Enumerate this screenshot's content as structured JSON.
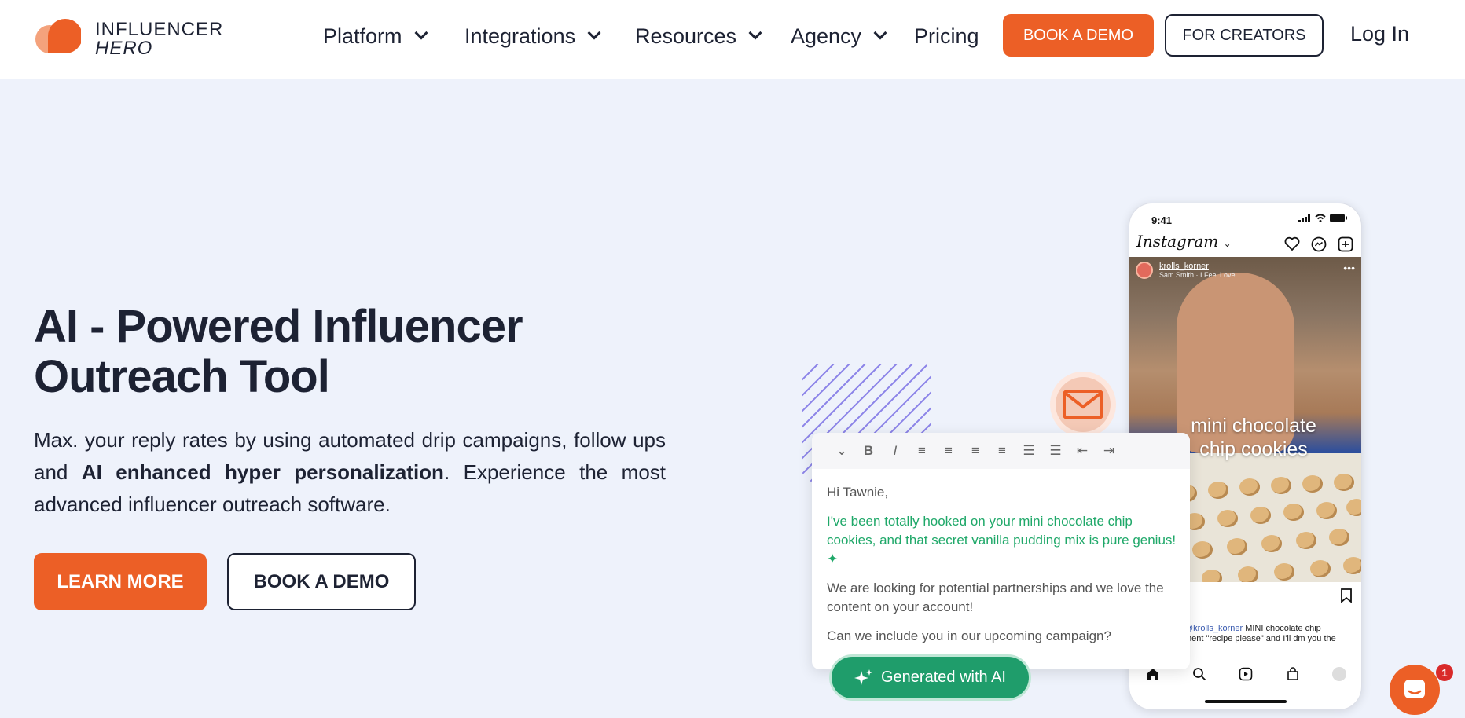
{
  "brand": {
    "line1": "INFLUENCER",
    "line2": "HERO",
    "accent": "#ec5f26",
    "ink": "#1d2233",
    "background": "#eef2fb"
  },
  "nav": {
    "items": [
      {
        "label": "Platform",
        "has_dropdown": true
      },
      {
        "label": "Integrations",
        "has_dropdown": true
      },
      {
        "label": "Resources",
        "has_dropdown": true
      },
      {
        "label": "Agency",
        "has_dropdown": true
      },
      {
        "label": "Pricing",
        "has_dropdown": false
      }
    ],
    "book_demo": "BOOK A DEMO",
    "for_creators": "FOR CREATORS",
    "login": "Log In"
  },
  "hero": {
    "title_line1": "AI - Powered Influencer",
    "title_line2": "Outreach Tool",
    "desc_part1": "Max. your reply rates by using automated drip campaigns, follow ups and ",
    "desc_bold": "AI enhanced hyper personalization",
    "desc_part2": ". Experience the most advanced influencer outreach software.",
    "learn_more": "LEARN MORE",
    "book_demo": "BOOK A DEMO"
  },
  "phone": {
    "time": "9:41",
    "app": "Instagram",
    "username": "krolls_korner",
    "song": "Sam Smith · I Feel Love",
    "overlay_line1": "mini chocolate",
    "overlay_line2": "chip cookies",
    "caption_tag": "@krolls_korner",
    "caption_text1": " MINI chocolate chip",
    "caption_text2": "ment \"recipe please\" and I'll dm you the"
  },
  "editor": {
    "greeting": "Hi Tawnie,",
    "personalized": "I've been totally hooked on your mini chocolate chip cookies, and that secret vanilla pudding mix is pure genius! ✦",
    "body1": "We are looking for potential partnerships and we love the content on your account!",
    "body2": "Can we include you in our upcoming campaign?",
    "toolbar": [
      "⌄",
      "B",
      "I",
      "≡",
      "≡",
      "≡",
      "≡",
      "☰",
      "☰",
      "⇤",
      "⇥"
    ]
  },
  "badge": {
    "generated": "Generated with AI"
  },
  "chat": {
    "unread": "1"
  }
}
